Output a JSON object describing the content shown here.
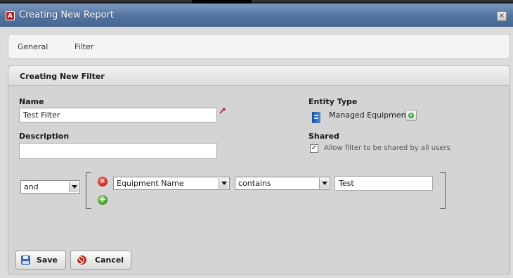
{
  "window": {
    "title": "Creating New Report",
    "close_glyph": "×"
  },
  "tabs": [
    "General",
    "Filter"
  ],
  "filter_panel": {
    "title": "Creating New Filter",
    "name_label": "Name",
    "name_value": "Test Filter",
    "description_label": "Description",
    "description_value": "",
    "entity_type_label": "Entity Type",
    "entity_type_value": "Managed Equipment",
    "shared_label": "Shared",
    "shared_checked": true,
    "shared_option_label": "Allow filter to be shared by all users"
  },
  "condition": {
    "logic_operator": "and",
    "field": "Equipment Name",
    "operator": "contains",
    "value": "Test"
  },
  "buttons": {
    "save": "Save",
    "cancel": "Cancel"
  },
  "icons": {
    "app": "report-icon",
    "pin": "pin-icon",
    "entity": "device-icon",
    "add": "plus-icon",
    "remove": "remove-icon",
    "save": "floppy-disk-icon",
    "cancel": "cancel-icon"
  },
  "colors": {
    "title_bar": "#5273a1",
    "remove": "#c42a1c",
    "add": "#3a9a26"
  }
}
